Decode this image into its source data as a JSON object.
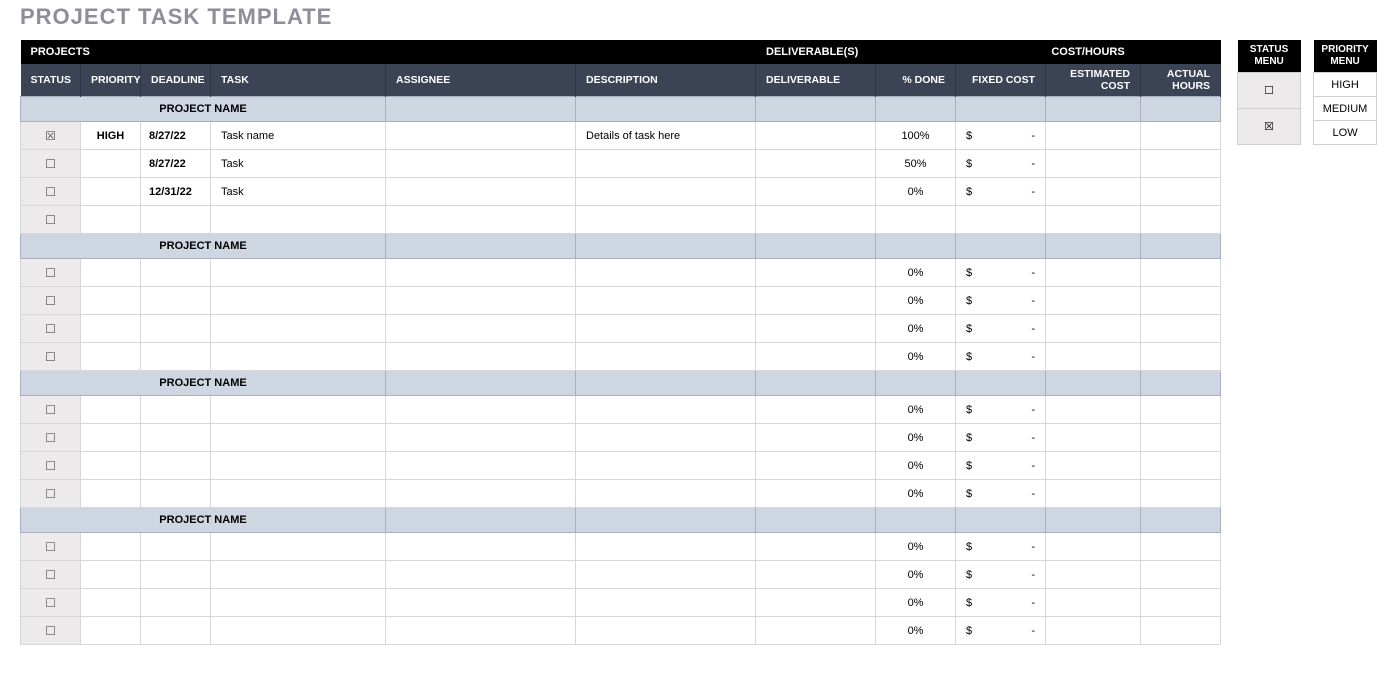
{
  "title": "PROJECT TASK TEMPLATE",
  "groupHeaders": {
    "projects": "PROJECTS",
    "deliverables": "DELIVERABLE(S)",
    "costHours": "COST/HOURS"
  },
  "columns": {
    "status": "STATUS",
    "priority": "PRIORITY",
    "deadline": "DEADLINE",
    "task": "TASK",
    "assignee": "ASSIGNEE",
    "description": "DESCRIPTION",
    "deliverable": "DELIVERABLE",
    "pctDone": "% DONE",
    "fixedCost": "FIXED COST",
    "estimatedCost": "ESTIMATED COST",
    "actualHours": "ACTUAL HOURS"
  },
  "glyphs": {
    "checked": "☒",
    "unchecked": "☐",
    "dollar": "$",
    "dash": "-"
  },
  "projects": [
    {
      "name": "PROJECT NAME",
      "tasks": [
        {
          "checked": true,
          "priority": "HIGH",
          "deadline": "8/27/22",
          "task": "Task name",
          "assignee": "",
          "description": "Details of task here",
          "deliverable": "",
          "pctDone": "100%",
          "fixed": true,
          "est": "",
          "actual": ""
        },
        {
          "checked": false,
          "priority": "",
          "deadline": "8/27/22",
          "task": "Task",
          "assignee": "",
          "description": "",
          "deliverable": "",
          "pctDone": "50%",
          "fixed": true,
          "est": "",
          "actual": ""
        },
        {
          "checked": false,
          "priority": "",
          "deadline": "12/31/22",
          "task": "Task",
          "assignee": "",
          "description": "",
          "deliverable": "",
          "pctDone": "0%",
          "fixed": true,
          "est": "",
          "actual": ""
        },
        {
          "checked": false,
          "priority": "",
          "deadline": "",
          "task": "",
          "assignee": "",
          "description": "",
          "deliverable": "",
          "pctDone": "",
          "fixed": false,
          "est": "",
          "actual": ""
        }
      ]
    },
    {
      "name": "PROJECT NAME",
      "tasks": [
        {
          "checked": false,
          "priority": "",
          "deadline": "",
          "task": "",
          "assignee": "",
          "description": "",
          "deliverable": "",
          "pctDone": "0%",
          "fixed": true,
          "est": "",
          "actual": ""
        },
        {
          "checked": false,
          "priority": "",
          "deadline": "",
          "task": "",
          "assignee": "",
          "description": "",
          "deliverable": "",
          "pctDone": "0%",
          "fixed": true,
          "est": "",
          "actual": ""
        },
        {
          "checked": false,
          "priority": "",
          "deadline": "",
          "task": "",
          "assignee": "",
          "description": "",
          "deliverable": "",
          "pctDone": "0%",
          "fixed": true,
          "est": "",
          "actual": ""
        },
        {
          "checked": false,
          "priority": "",
          "deadline": "",
          "task": "",
          "assignee": "",
          "description": "",
          "deliverable": "",
          "pctDone": "0%",
          "fixed": true,
          "est": "",
          "actual": ""
        }
      ]
    },
    {
      "name": "PROJECT NAME",
      "tasks": [
        {
          "checked": false,
          "priority": "",
          "deadline": "",
          "task": "",
          "assignee": "",
          "description": "",
          "deliverable": "",
          "pctDone": "0%",
          "fixed": true,
          "est": "",
          "actual": ""
        },
        {
          "checked": false,
          "priority": "",
          "deadline": "",
          "task": "",
          "assignee": "",
          "description": "",
          "deliverable": "",
          "pctDone": "0%",
          "fixed": true,
          "est": "",
          "actual": ""
        },
        {
          "checked": false,
          "priority": "",
          "deadline": "",
          "task": "",
          "assignee": "",
          "description": "",
          "deliverable": "",
          "pctDone": "0%",
          "fixed": true,
          "est": "",
          "actual": ""
        },
        {
          "checked": false,
          "priority": "",
          "deadline": "",
          "task": "",
          "assignee": "",
          "description": "",
          "deliverable": "",
          "pctDone": "0%",
          "fixed": true,
          "est": "",
          "actual": ""
        }
      ]
    },
    {
      "name": "PROJECT NAME",
      "tasks": [
        {
          "checked": false,
          "priority": "",
          "deadline": "",
          "task": "",
          "assignee": "",
          "description": "",
          "deliverable": "",
          "pctDone": "0%",
          "fixed": true,
          "est": "",
          "actual": ""
        },
        {
          "checked": false,
          "priority": "",
          "deadline": "",
          "task": "",
          "assignee": "",
          "description": "",
          "deliverable": "",
          "pctDone": "0%",
          "fixed": true,
          "est": "",
          "actual": ""
        },
        {
          "checked": false,
          "priority": "",
          "deadline": "",
          "task": "",
          "assignee": "",
          "description": "",
          "deliverable": "",
          "pctDone": "0%",
          "fixed": true,
          "est": "",
          "actual": ""
        },
        {
          "checked": false,
          "priority": "",
          "deadline": "",
          "task": "",
          "assignee": "",
          "description": "",
          "deliverable": "",
          "pctDone": "0%",
          "fixed": true,
          "est": "",
          "actual": ""
        }
      ]
    }
  ],
  "statusMenu": {
    "title1": "STATUS",
    "title2": "MENU",
    "rows": [
      {
        "glyph": "☐"
      },
      {
        "glyph": "☒"
      }
    ]
  },
  "priorityMenu": {
    "title1": "PRIORITY",
    "title2": "MENU",
    "rows": [
      {
        "label": "HIGH"
      },
      {
        "label": "MEDIUM"
      },
      {
        "label": "LOW"
      }
    ]
  }
}
